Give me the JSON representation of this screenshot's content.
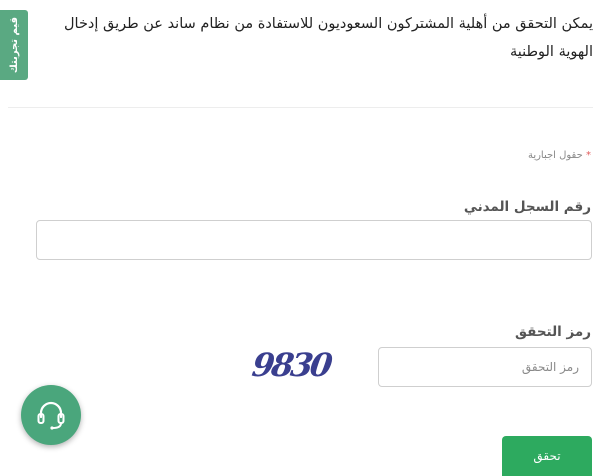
{
  "intro": {
    "text": "يمكن التحقق من أهلية المشتركون السعوديون للاستفادة من نظام ساند عن طريق إدخال الهوية الوطنية"
  },
  "rate_tab": {
    "label": "قيم تجربتك"
  },
  "form": {
    "required_note": "حقول اجبارية",
    "id_label": "رقم السجل المدني",
    "id_value": "",
    "captcha_label": "رمز التحقق",
    "captcha_placeholder": "رمز التحقق",
    "captcha_image_text": "9830",
    "submit_label": "تحقق"
  },
  "support": {
    "icon": "headset-icon"
  },
  "colors": {
    "primary_green": "#2daa5f",
    "tab_green": "#5aa982",
    "fab_green": "#4aa67c",
    "captcha_blue": "#3a3f8f",
    "required_star": "#e25c5c"
  }
}
